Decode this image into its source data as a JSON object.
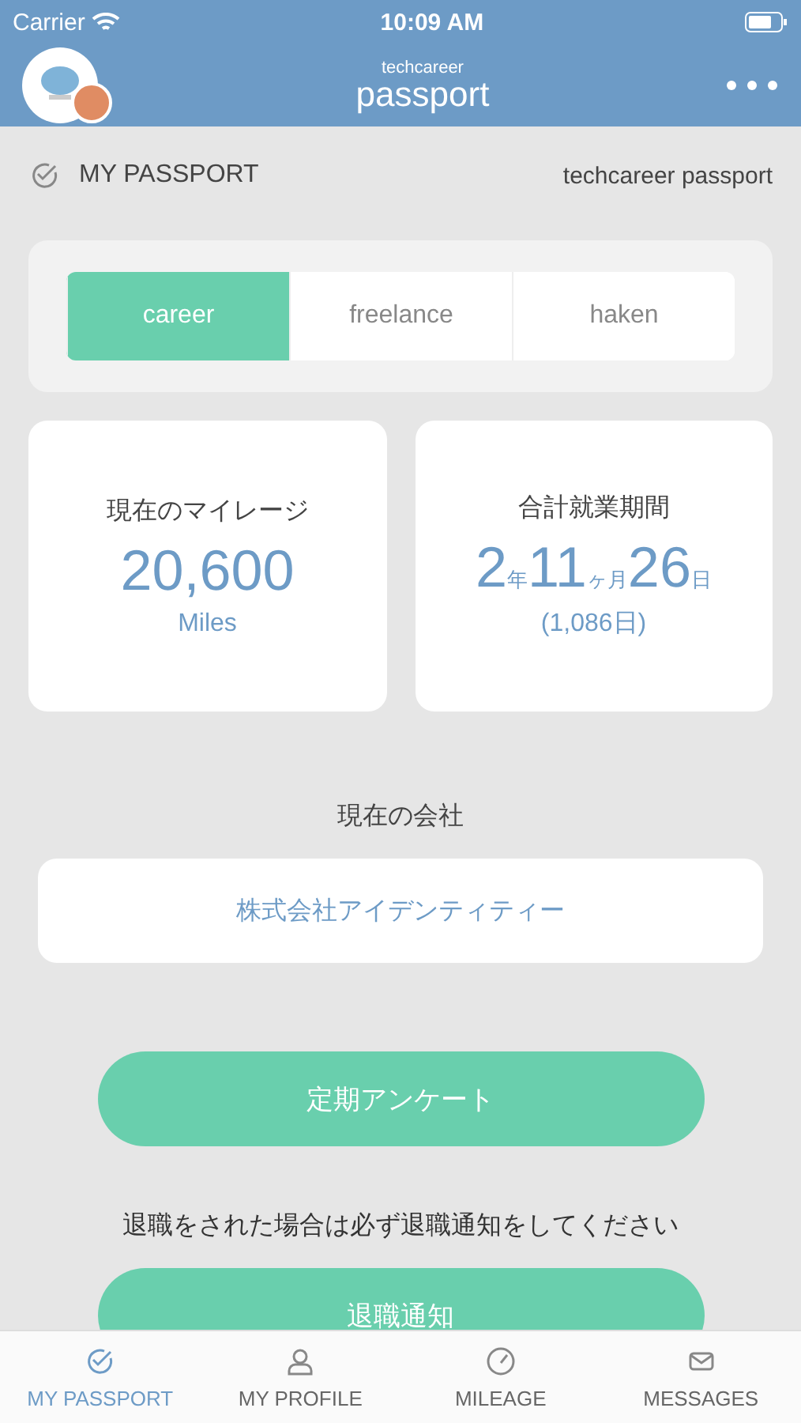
{
  "status_bar": {
    "carrier": "Carrier",
    "time": "10:09 AM"
  },
  "header": {
    "logo_small": "techcareer",
    "logo_large": "passport"
  },
  "section": {
    "title": "MY PASSPORT",
    "subtitle": "techcareer passport"
  },
  "segments": [
    {
      "label": "career",
      "selected": true
    },
    {
      "label": "freelance",
      "selected": false
    },
    {
      "label": "haken",
      "selected": false
    }
  ],
  "mileage": {
    "label": "現在のマイレージ",
    "value": "20,600",
    "unit": "Miles"
  },
  "duration": {
    "label": "合計就業期間",
    "parts": [
      {
        "value": "2",
        "unit": "年"
      },
      {
        "value": "11",
        "unit": "ヶ月"
      },
      {
        "value": "26",
        "unit": "日"
      }
    ],
    "total": "(1,086日)"
  },
  "company": {
    "label": "現在の会社",
    "name": "株式会社アイデンティティー"
  },
  "survey_button": "定期アンケート",
  "notice": "退職をされた場合は必ず退職通知をしてください",
  "retire_button": "退職通知",
  "tabs": [
    {
      "label": "MY PASSPORT",
      "kind": "passport",
      "selected": true
    },
    {
      "label": "MY PROFILE",
      "kind": "profile",
      "selected": false
    },
    {
      "label": "MILEAGE",
      "kind": "mileage",
      "selected": false
    },
    {
      "label": "MESSAGES",
      "kind": "messages",
      "selected": false
    }
  ]
}
